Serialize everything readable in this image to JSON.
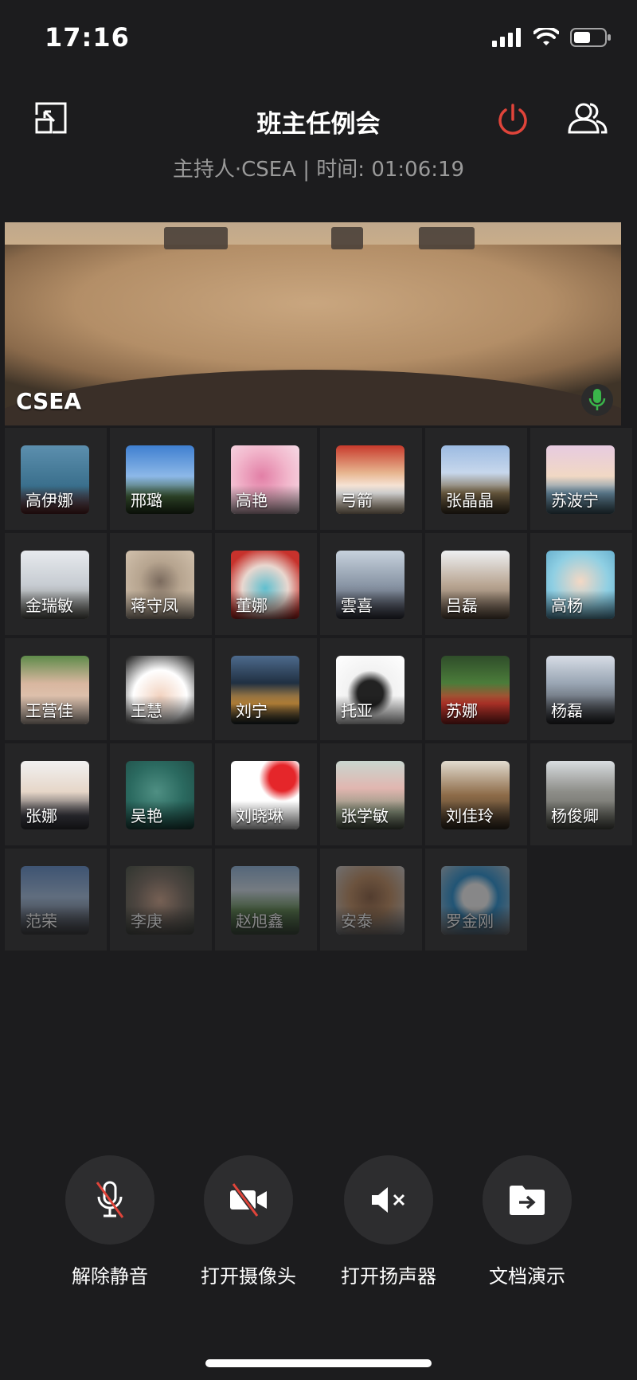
{
  "status": {
    "time": "17:16"
  },
  "header": {
    "title": "班主任例会",
    "subtitle": "主持人·CSEA | 时间: 01:06:19"
  },
  "main_video": {
    "speaker": "CSEA"
  },
  "participants": [
    {
      "name": "高伊娜",
      "bg": "linear-gradient(180deg,#5c8fae,#3a6f8c 60%,#6a2a2a)"
    },
    {
      "name": "邢璐",
      "bg": "linear-gradient(180deg,#3f7fd0 0%,#8cb8e8 45%,#3c5a34 75%,#2a3e22)"
    },
    {
      "name": "高艳",
      "bg": "radial-gradient(circle at 45% 45%,#e27fa6,#f2b7cc 50%,#f6e1ea)"
    },
    {
      "name": "弓箭",
      "bg": "linear-gradient(180deg,#c83a2c,#e7b58f 40%,#ffffff 70%,#d8c0a0)"
    },
    {
      "name": "张晶晶",
      "bg": "linear-gradient(180deg,#9cbbe2,#c7d7ec 40%,#7b6848 70%,#4b3e2c)"
    },
    {
      "name": "苏波宁",
      "bg": "linear-gradient(180deg,#e7cbe0,#f1d8c4 45%,#6b8fa6 70%,#4a6a78)"
    },
    {
      "name": "金瑞敏",
      "bg": "linear-gradient(180deg,#e7eaee,#c7ccd2 50%,#6d6d66)"
    },
    {
      "name": "蒋守凤",
      "bg": "radial-gradient(circle at 50% 45%,#7b6b5e,#b6a48f 40%,#d6c6b2)"
    },
    {
      "name": "董娜",
      "bg": "radial-gradient(circle at 50% 55%,#5fbfcf,#e9d7cf 45%,#c7322c 80%)"
    },
    {
      "name": "雲喜",
      "bg": "linear-gradient(180deg,#c7d2dd,#8a96a6 50%,#3a3c48)"
    },
    {
      "name": "吕磊",
      "bg": "linear-gradient(180deg,#eef0f2,#b9a693 50%,#6a5848)"
    },
    {
      "name": "高杨",
      "bg": "radial-gradient(circle at 50% 45%,#f4d8c4,#8fcfe3 55%,#5fa9c9)"
    },
    {
      "name": "王营佳",
      "bg": "linear-gradient(180deg,#5e8b4a,#d8b69f 40%,#e9d6c7)"
    },
    {
      "name": "王慧",
      "bg": "radial-gradient(circle at 50% 60%,#f2d2bf,#ffffff 50%,#111)"
    },
    {
      "name": "刘宁",
      "bg": "linear-gradient(180deg,#4d6a8c,#203042 40%,#d99b43 70%,#1d2a2f)"
    },
    {
      "name": "托亚",
      "bg": "radial-gradient(circle at 50% 55%,#222 25%,#f2f2f2 45%,#ffffff)"
    },
    {
      "name": "苏娜",
      "bg": "linear-gradient(180deg,#2f4d2a,#4b7c3a 40%,#d23b2f 70%,#a92b28)"
    },
    {
      "name": "杨磊",
      "bg": "linear-gradient(180deg,#d7dde6,#9aa6b4 40%,#2c2c30)"
    },
    {
      "name": "张娜",
      "bg": "linear-gradient(180deg,#f1f1f1,#e6d6c8 45%,#3c3c44 80%)"
    },
    {
      "name": "吴艳",
      "bg": "radial-gradient(circle at 45% 45%,#4f8f83,#2b6a60 50%,#1e4a44)"
    },
    {
      "name": "刘晓琳",
      "bg": "radial-gradient(circle at 75% 25%,#e5262a 18%,#ffffff 32%,#ffffff)"
    },
    {
      "name": "张学敏",
      "bg": "linear-gradient(180deg,#c9d6cf,#e1b6b0 40%,#86917a 75%,#5b6455)"
    },
    {
      "name": "刘佳玲",
      "bg": "linear-gradient(180deg,#e2dcd0,#8d6b48 50%,#3c3226)"
    },
    {
      "name": "杨俊卿",
      "bg": "linear-gradient(180deg,#d9dde0,#8d8d88 45%,#5d5f56)"
    },
    {
      "name": "范荣",
      "bg": "linear-gradient(180deg,#5e8ed0,#a9c6ea 45%,#3a3a40)"
    },
    {
      "name": "李庚",
      "bg": "radial-gradient(circle at 50% 50%,#d9a98d,#7d6d60 50%,#3f4a3c)"
    },
    {
      "name": "赵旭鑫",
      "bg": "linear-gradient(180deg,#8fb7e0,#d6e4f1 35%,#5b8a4a 65%,#2f5a2c)"
    },
    {
      "name": "安泰",
      "bg": "radial-gradient(circle at 50% 45%,#8a5a3a,#c28b5c 40%,#cfd6de)"
    },
    {
      "name": "罗金刚",
      "bg": "radial-gradient(circle at 50% 45%,#ffffff 25%,#1d8fd6 45%,#c7ccd2)"
    }
  ],
  "controls": [
    {
      "label": "解除静音",
      "icon": "mic-muted-icon"
    },
    {
      "label": "打开摄像头",
      "icon": "camera-off-icon"
    },
    {
      "label": "打开扬声器",
      "icon": "speaker-muted-icon"
    },
    {
      "label": "文档演示",
      "icon": "folder-share-icon"
    }
  ],
  "colors": {
    "power": "#e0443a",
    "mic_active": "#3ab54a",
    "mute_slash": "#e0443a"
  }
}
